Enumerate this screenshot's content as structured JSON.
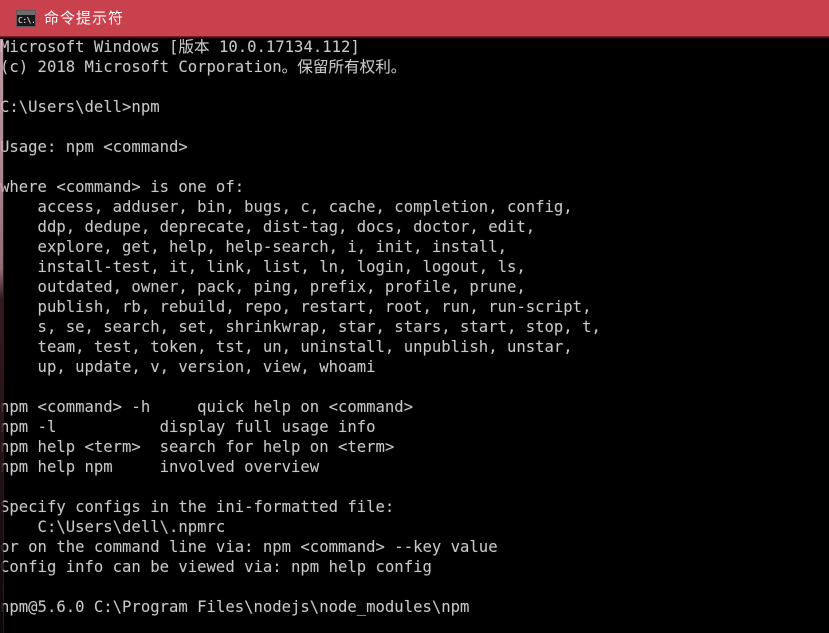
{
  "window": {
    "title": "命令提示符",
    "icon": "cmd-console-icon",
    "icon_glyph": "C:\\.",
    "titlebar_color": "#c9414c",
    "background_color": "#000000",
    "text_color": "#c8c8c8"
  },
  "console": {
    "lines": [
      "Microsoft Windows [版本 10.0.17134.112]",
      "(c) 2018 Microsoft Corporation。保留所有权利。",
      "",
      "C:\\Users\\dell>npm",
      "",
      "Usage: npm <command>",
      "",
      "where <command> is one of:",
      "    access, adduser, bin, bugs, c, cache, completion, config,",
      "    ddp, dedupe, deprecate, dist-tag, docs, doctor, edit,",
      "    explore, get, help, help-search, i, init, install,",
      "    install-test, it, link, list, ln, login, logout, ls,",
      "    outdated, owner, pack, ping, prefix, profile, prune,",
      "    publish, rb, rebuild, repo, restart, root, run, run-script,",
      "    s, se, search, set, shrinkwrap, star, stars, start, stop, t,",
      "    team, test, token, tst, un, uninstall, unpublish, unstar,",
      "    up, update, v, version, view, whoami",
      "",
      "npm <command> -h     quick help on <command>",
      "npm -l           display full usage info",
      "npm help <term>  search for help on <term>",
      "npm help npm     involved overview",
      "",
      "Specify configs in the ini-formatted file:",
      "    C:\\Users\\dell\\.npmrc",
      "or on the command line via: npm <command> --key value",
      "Config info can be viewed via: npm help config",
      "",
      "npm@5.6.0 C:\\Program Files\\nodejs\\node_modules\\npm"
    ],
    "prompt_path": "C:\\Users\\dell",
    "command_entered": "npm",
    "npm_version": "npm@5.6.0",
    "npm_path": "C:\\Program Files\\nodejs\\node_modules\\npm",
    "os_version": "10.0.17134.112",
    "copyright_year": "2018"
  }
}
